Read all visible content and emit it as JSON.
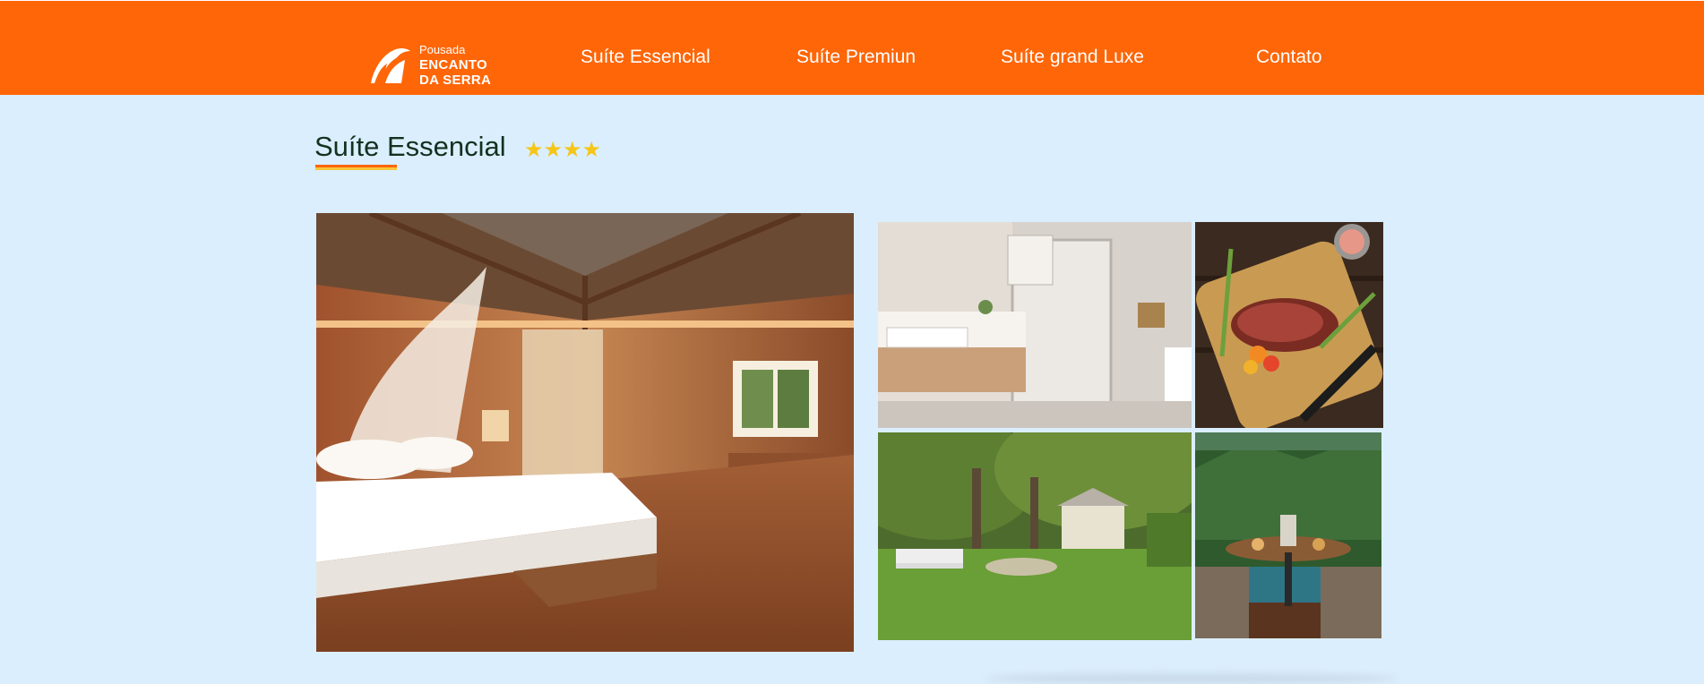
{
  "header": {
    "logo": {
      "line1": "Pousada",
      "line2": "ENCANTO",
      "line3": "DA SERRA"
    },
    "nav": [
      {
        "label": "Suíte Essencial"
      },
      {
        "label": "Suíte Premiun"
      },
      {
        "label": "Suíte grand Luxe"
      },
      {
        "label": "Contato"
      }
    ]
  },
  "main": {
    "title": "Suíte Essencial",
    "stars": "★★★★",
    "rating": 4
  },
  "colors": {
    "header_bg": "#fe6608",
    "page_bg": "#dbeefd",
    "title": "#12311f",
    "star": "#f5c518"
  }
}
